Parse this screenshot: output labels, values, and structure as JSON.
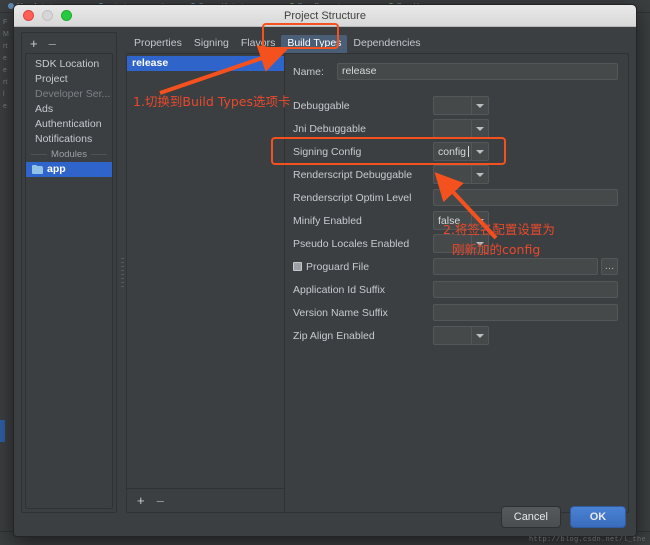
{
  "background_ide": {
    "editor_tabs": [
      "MainActivity.java",
      "activity_main.xml",
      "SecondActivity.java",
      "BasePresenter.java",
      "BaseVi"
    ],
    "left_gutter_text": "F M rt e e rt l e",
    "status_text": ""
  },
  "window": {
    "title": "Project Structure",
    "controls": {
      "close": "close-button",
      "minimize": "minimize-button",
      "maximize": "maximize-button"
    }
  },
  "sidebar": {
    "add_label": "+",
    "remove_label": "–",
    "items": [
      {
        "label": "SDK Location",
        "state": "normal"
      },
      {
        "label": "Project",
        "state": "normal"
      },
      {
        "label": "Developer Ser...",
        "state": "disabled"
      },
      {
        "label": "Ads",
        "state": "normal"
      },
      {
        "label": "Authentication",
        "state": "normal"
      },
      {
        "label": "Notifications",
        "state": "normal"
      }
    ],
    "group_label": "Modules",
    "modules": [
      {
        "label": "app",
        "icon": "folder-icon",
        "selected": true
      }
    ]
  },
  "tabs": [
    {
      "label": "Properties",
      "active": false
    },
    {
      "label": "Signing",
      "active": false
    },
    {
      "label": "Flavors",
      "active": false
    },
    {
      "label": "Build Types",
      "active": true
    },
    {
      "label": "Dependencies",
      "active": false
    }
  ],
  "build_types_list": {
    "items": [
      {
        "label": "release",
        "selected": true
      }
    ],
    "add_label": "+",
    "remove_label": "–"
  },
  "form": {
    "name_label": "Name:",
    "name_value": "release",
    "fields": [
      {
        "label": "Debuggable",
        "type": "combo",
        "value": ""
      },
      {
        "label": "Jni Debuggable",
        "type": "combo",
        "value": ""
      },
      {
        "label": "Signing Config",
        "type": "combo",
        "value": "config",
        "focused": true
      },
      {
        "label": "Renderscript Debuggable",
        "type": "combo",
        "value": ""
      },
      {
        "label": "Renderscript Optim Level",
        "type": "text",
        "value": ""
      },
      {
        "label": "Minify Enabled",
        "type": "combo",
        "value": "false"
      },
      {
        "label": "Pseudo Locales Enabled",
        "type": "combo",
        "value": ""
      },
      {
        "label": "Proguard File",
        "type": "file",
        "value": "",
        "checkbox": true,
        "browse_label": "…"
      },
      {
        "label": "Application Id Suffix",
        "type": "text",
        "value": ""
      },
      {
        "label": "Version Name Suffix",
        "type": "text",
        "value": ""
      },
      {
        "label": "Zip Align Enabled",
        "type": "combo",
        "value": ""
      }
    ]
  },
  "footer": {
    "cancel_label": "Cancel",
    "ok_label": "OK"
  },
  "annotations": [
    {
      "id": "step-1",
      "text": "1.切换到Build Types选项卡"
    },
    {
      "id": "step-2",
      "line1": "2.将签名配置设置为",
      "line2": "刚新加的config"
    }
  ],
  "watermark": "http://blog.csdn.net/l_the"
}
